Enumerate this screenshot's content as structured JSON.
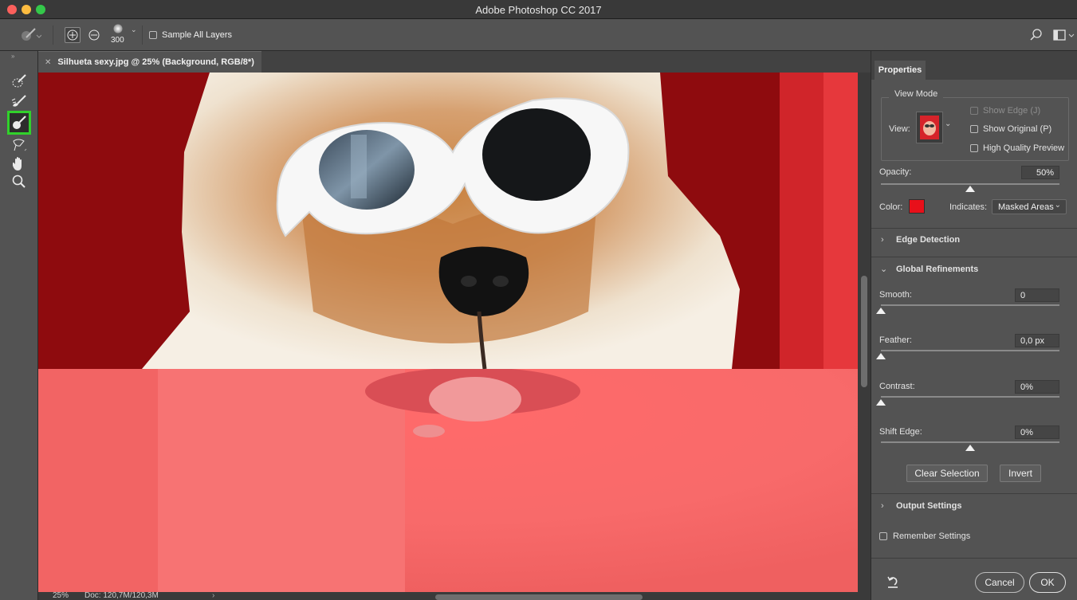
{
  "window": {
    "title": "Adobe Photoshop CC 2017"
  },
  "optionsbar": {
    "brush_size": "300",
    "sample_all_layers_label": "Sample All Layers"
  },
  "document": {
    "tab_title": "Silhueta sexy.jpg @ 25% (Background, RGB/8*)",
    "zoom": "25%",
    "doc_info": "Doc: 120,7M/120,3M"
  },
  "properties": {
    "tab_label": "Properties",
    "view_mode": {
      "heading": "View Mode",
      "view_label": "View:",
      "show_edge_label": "Show Edge (J)",
      "show_original_label": "Show Original (P)",
      "hq_preview_label": "High Quality Preview"
    },
    "opacity": {
      "label": "Opacity:",
      "value": "50%",
      "fraction": 0.5
    },
    "color": {
      "label": "Color:",
      "swatch": "#e8101a"
    },
    "indicates": {
      "label": "Indicates:",
      "value": "Masked Areas"
    },
    "edge_detection": {
      "label": "Edge Detection"
    },
    "global_refinements": {
      "label": "Global Refinements",
      "smooth": {
        "label": "Smooth:",
        "value": "0",
        "fraction": 0.0
      },
      "feather": {
        "label": "Feather:",
        "value": "0,0 px",
        "fraction": 0.0
      },
      "contrast": {
        "label": "Contrast:",
        "value": "0%",
        "fraction": 0.0
      },
      "shift_edge": {
        "label": "Shift Edge:",
        "value": "0%",
        "fraction": 0.5
      }
    },
    "buttons": {
      "clear_selection": "Clear Selection",
      "invert": "Invert",
      "cancel": "Cancel",
      "ok": "OK"
    },
    "output_settings": {
      "label": "Output Settings"
    },
    "remember_settings": {
      "label": "Remember Settings"
    }
  },
  "colors": {
    "mask_overlay": "#ff3b3b",
    "highlight_tool": "#31d12b",
    "panel_bg": "#535353"
  }
}
